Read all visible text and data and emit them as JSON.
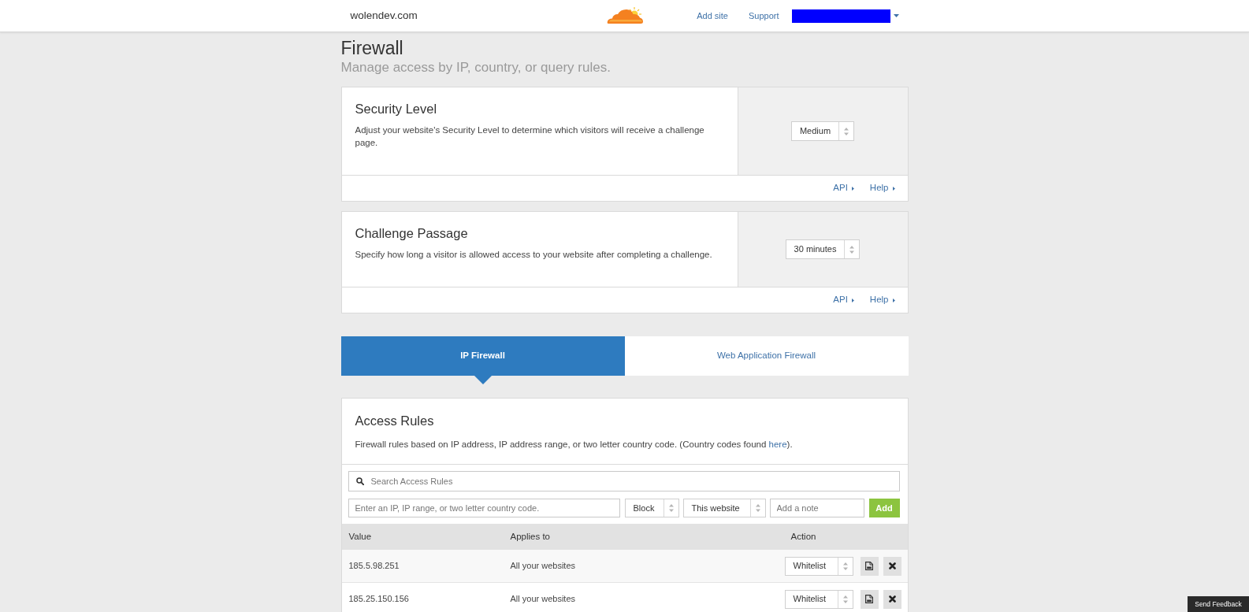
{
  "top_bar": {
    "domain": "wolendev.com",
    "links": [
      {
        "label": "Add site"
      },
      {
        "label": "Support"
      }
    ]
  },
  "page_header": {
    "title": "Firewall",
    "subtitle": "Manage access by IP, country, or query rules."
  },
  "settings_cards": [
    {
      "title": "Security Level",
      "description": "Adjust your website's Security Level to determine which visitors will receive a challenge page.",
      "select_value": "Medium",
      "footer_links": [
        "API",
        "Help"
      ]
    },
    {
      "title": "Challenge Passage",
      "description": "Specify how long a visitor is allowed access to your website after completing a challenge.",
      "select_value": "30 minutes",
      "footer_links": [
        "API",
        "Help"
      ]
    }
  ],
  "tabs": [
    {
      "label": "IP Firewall",
      "selected": true
    },
    {
      "label": "Web Application Firewall",
      "selected": false
    }
  ],
  "access_rules": {
    "title": "Access Rules",
    "description": "Firewall rules based on IP address, IP address range, or two letter country code. (Country codes found ",
    "description_link": "here",
    "description_end": ").",
    "search": {
      "placeholder": "Search Access Rules"
    },
    "new_rule": {
      "value_placeholder": "Enter an IP, IP range, or two letter country code.",
      "mode": "Block",
      "scope": "This website",
      "note_placeholder": "Add a note",
      "add_button": "Add"
    }
  },
  "table": {
    "columns": [
      "Value",
      "Applies to",
      "Action"
    ],
    "rows": [
      {
        "value": "185.5.98.251",
        "applies_to": "All your websites",
        "action": "Whitelist"
      },
      {
        "value": "185.25.150.156",
        "applies_to": "All your websites",
        "action": "Whitelist"
      }
    ]
  },
  "feedback_button": "Send Feedback"
}
